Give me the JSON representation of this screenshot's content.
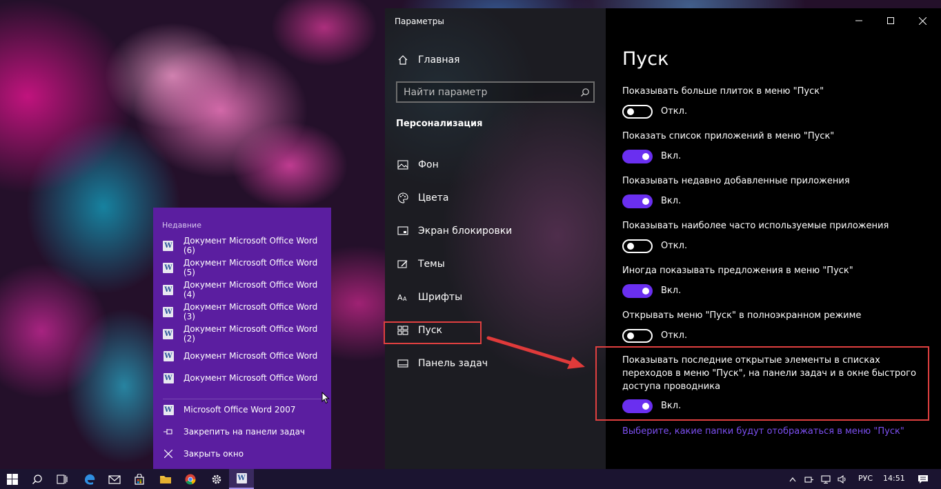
{
  "window": {
    "title": "Параметры",
    "home_label": "Главная",
    "search_placeholder": "Найти параметр",
    "section": "Персонализация",
    "nav_items": [
      {
        "label": "Фон",
        "icon": "image-icon"
      },
      {
        "label": "Цвета",
        "icon": "palette-icon"
      },
      {
        "label": "Экран блокировки",
        "icon": "lock-screen-icon"
      },
      {
        "label": "Темы",
        "icon": "themes-icon"
      },
      {
        "label": "Шрифты",
        "icon": "fonts-icon"
      },
      {
        "label": "Пуск",
        "icon": "start-icon",
        "selected": true
      },
      {
        "label": "Панель задач",
        "icon": "taskbar-icon"
      }
    ]
  },
  "page": {
    "title": "Пуск",
    "options": [
      {
        "label": "Показывать больше плиток в меню \"Пуск\"",
        "state": "Откл.",
        "on": false
      },
      {
        "label": "Показать список приложений в меню \"Пуск\"",
        "state": "Вкл.",
        "on": true
      },
      {
        "label": "Показывать недавно добавленные приложения",
        "state": "Вкл.",
        "on": true
      },
      {
        "label": "Показывать наиболее часто используемые приложения",
        "state": "Откл.",
        "on": false
      },
      {
        "label": "Иногда показывать предложения в меню \"Пуск\"",
        "state": "Вкл.",
        "on": true
      },
      {
        "label": "Открывать меню \"Пуск\" в полноэкранном режиме",
        "state": "Откл.",
        "on": false
      },
      {
        "label": "Показывать последние открытые элементы в списках переходов в меню \"Пуск\", на панели задач и в окне быстрого доступа проводника",
        "state": "Вкл.",
        "on": true
      }
    ],
    "link": "Выберите, какие папки будут отображаться в меню \"Пуск\""
  },
  "jumplist": {
    "header": "Недавние",
    "recent": [
      "Документ Microsoft Office Word (6)",
      "Документ Microsoft Office Word (5)",
      "Документ Microsoft Office Word (4)",
      "Документ Microsoft Office Word (3)",
      "Документ Microsoft Office Word (2)",
      "Документ Microsoft Office Word",
      "Документ Microsoft Office Word"
    ],
    "app": "Microsoft Office Word 2007",
    "pin": "Закрепить на панели задач",
    "close": "Закрыть окно"
  },
  "taskbar": {
    "language": "РУС",
    "time": "14:51"
  },
  "colors": {
    "accent": "#6a2ff0",
    "highlight_box": "#e04040",
    "link": "#7c4ff2",
    "jumplist_bg": "#5b1ea0"
  }
}
